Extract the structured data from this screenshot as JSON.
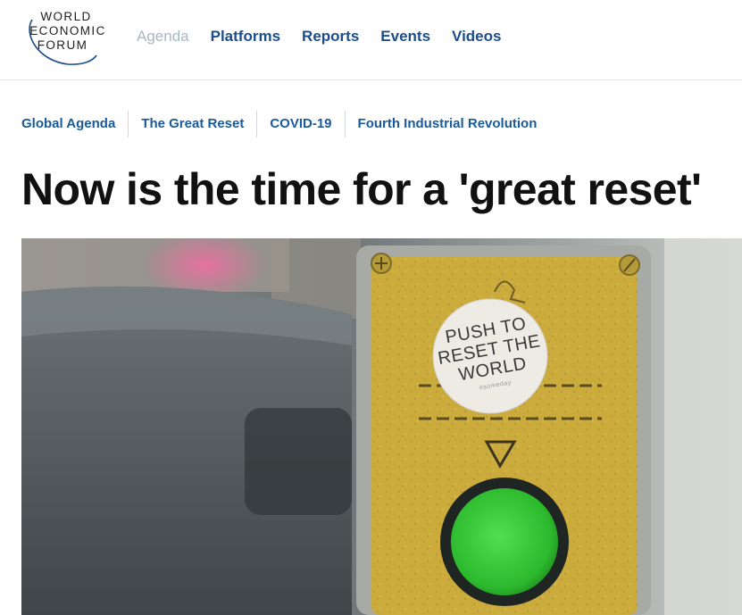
{
  "logo": {
    "line1": "WORLD",
    "line2": "ECONOMIC",
    "line3": "FORUM"
  },
  "nav": {
    "items": [
      {
        "label": "Agenda",
        "active": true
      },
      {
        "label": "Platforms"
      },
      {
        "label": "Reports"
      },
      {
        "label": "Events"
      },
      {
        "label": "Videos"
      }
    ]
  },
  "topics": [
    {
      "label": "Global Agenda"
    },
    {
      "label": "The Great Reset"
    },
    {
      "label": "COVID-19"
    },
    {
      "label": "Fourth Industrial Revolution"
    }
  ],
  "article": {
    "title": "Now is the time for a 'great reset'"
  },
  "hero": {
    "sticker_line1": "PUSH TO",
    "sticker_line2": "RESET THE",
    "sticker_line3": "WORLD",
    "sticker_small": "#someday"
  },
  "colors": {
    "nav_link": "#1c4d8c",
    "nav_active": "#a9b6c6",
    "topic_link": "#1a5a9a",
    "title": "#111111",
    "button_green": "#3cc43c",
    "panel_gold": "#c9a93a"
  }
}
